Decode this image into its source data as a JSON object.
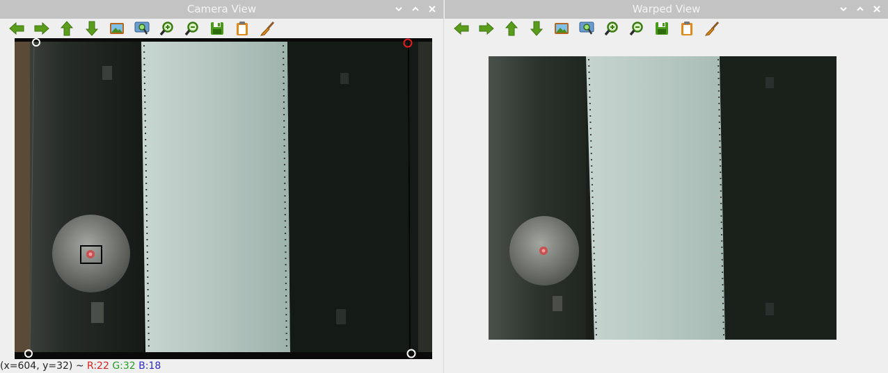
{
  "left_window": {
    "title": "Camera View"
  },
  "right_window": {
    "title": "Warped View"
  },
  "toolbar_icons": [
    "arrow-left-icon",
    "arrow-right-icon",
    "arrow-up-icon",
    "arrow-down-icon",
    "image-icon",
    "zoom-fit-icon",
    "zoom-in-icon",
    "zoom-out-icon",
    "save-icon",
    "copy-icon",
    "brush-icon"
  ],
  "status": {
    "coords": "(x=604, y=32) ~ ",
    "r": "R:22",
    "g": "G:32",
    "b": "B:18"
  },
  "colors": {
    "titlebar": "#c3c3c3",
    "toolbar_green": "#5a9d1c",
    "corner_selected": "#e41f1f",
    "paper": "#b9c9c3",
    "dark_surface": "#1d2520"
  }
}
